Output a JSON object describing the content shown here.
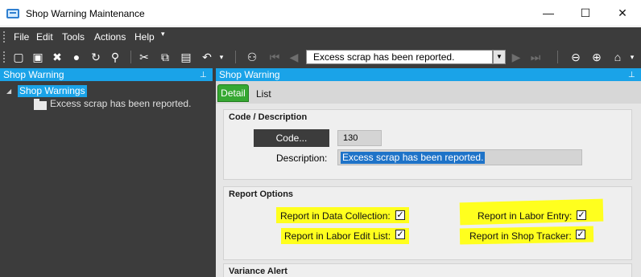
{
  "window": {
    "title": "Shop Warning Maintenance",
    "minimize": "—",
    "maximize": "☐",
    "close": "✕"
  },
  "menu": {
    "file": "File",
    "edit": "Edit",
    "tools": "Tools",
    "actions": "Actions",
    "help": "Help"
  },
  "toolbar": {
    "nav_value": "Excess scrap has been reported."
  },
  "left_panel": {
    "title": "Shop Warning",
    "tree_root": "Shop Warnings",
    "tree_child": "Excess scrap has been reported."
  },
  "right_panel": {
    "title": "Shop Warning",
    "tabs": {
      "detail": "Detail",
      "list": "List"
    }
  },
  "code_description": {
    "section_title": "Code / Description",
    "code_button": "Code...",
    "code_value": "130",
    "description_label": "Description:",
    "description_value": "Excess scrap has been reported."
  },
  "report_options": {
    "section_title": "Report Options",
    "data_collection": "Report in Data Collection:",
    "labor_entry": "Report in Labor Entry:",
    "labor_edit_list": "Report in Labor Edit List:",
    "shop_tracker": "Report in Shop Tracker:",
    "checked": "✓"
  },
  "variance_alert": {
    "section_title": "Variance Alert"
  },
  "colors": {
    "accent_blue": "#1aa3e8",
    "dark_chrome": "#3c3c3c",
    "tab_green": "#36a832",
    "highlight_yellow": "#ffff1e",
    "selection_blue": "#1e73c8"
  }
}
